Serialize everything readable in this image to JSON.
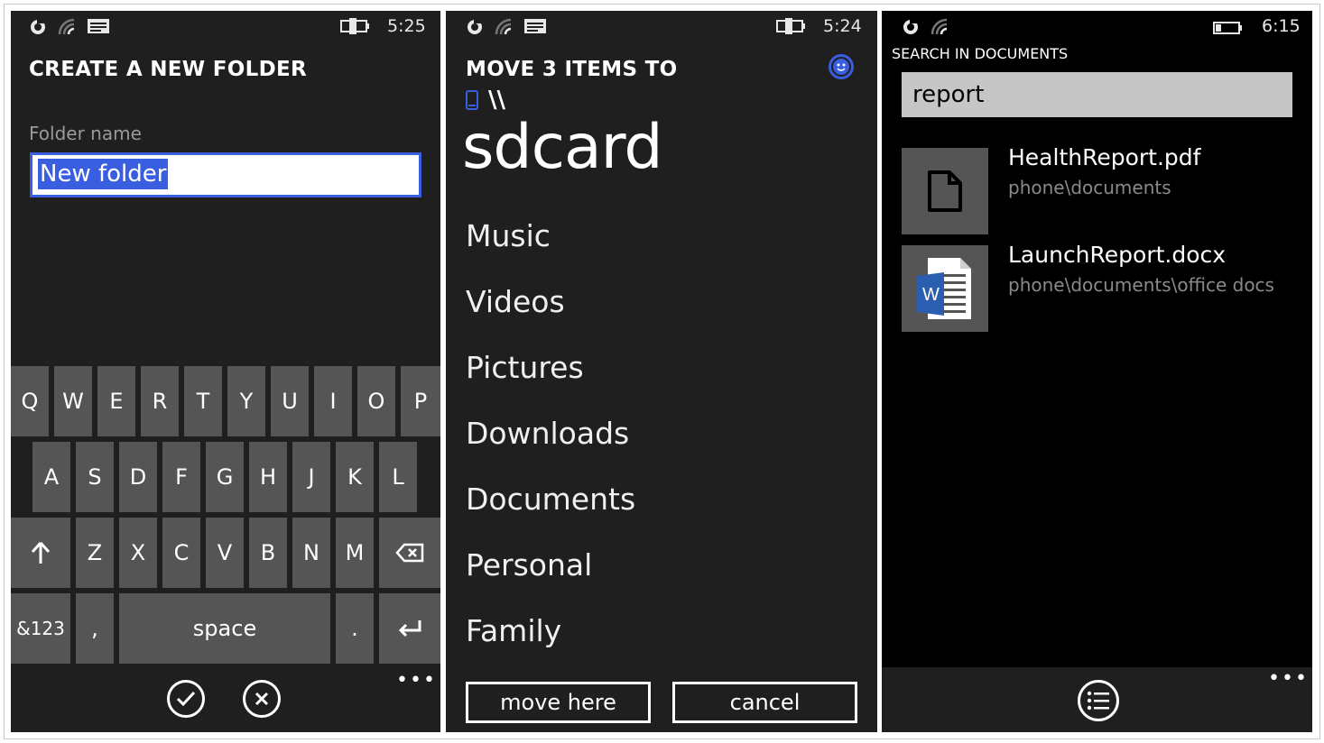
{
  "screen1": {
    "time": "5:25",
    "title": "CREATE A NEW FOLDER",
    "field_label": "Folder name",
    "field_value": "New folder",
    "keyboard": {
      "row1": [
        "Q",
        "W",
        "E",
        "R",
        "T",
        "Y",
        "U",
        "I",
        "O",
        "P"
      ],
      "row2": [
        "A",
        "S",
        "D",
        "F",
        "G",
        "H",
        "J",
        "K",
        "L"
      ],
      "row3": [
        "Z",
        "X",
        "C",
        "V",
        "B",
        "N",
        "M"
      ],
      "numbers_label": "&123",
      "comma": ",",
      "space_label": "space",
      "period": "."
    },
    "more": "•••"
  },
  "screen2": {
    "time": "5:24",
    "title": "MOVE 3 ITEMS TO",
    "path": "\\\\",
    "location": "sdcard",
    "folders": [
      "Music",
      "Videos",
      "Pictures",
      "Downloads",
      "Documents",
      "Personal",
      "Family"
    ],
    "move_label": "move here",
    "cancel_label": "cancel"
  },
  "screen3": {
    "time": "6:15",
    "title": "SEARCH IN DOCUMENTS",
    "query": "report",
    "results": [
      {
        "name": "HealthReport.pdf",
        "path": "phone\\documents",
        "icon": "document-icon"
      },
      {
        "name": "LaunchReport.docx",
        "path": "phone\\documents\\office docs",
        "icon": "word-document-icon"
      }
    ],
    "more": "•••"
  },
  "colors": {
    "accent": "#3a5ee0",
    "key": "#555555",
    "panel": "#1f1f1f"
  }
}
